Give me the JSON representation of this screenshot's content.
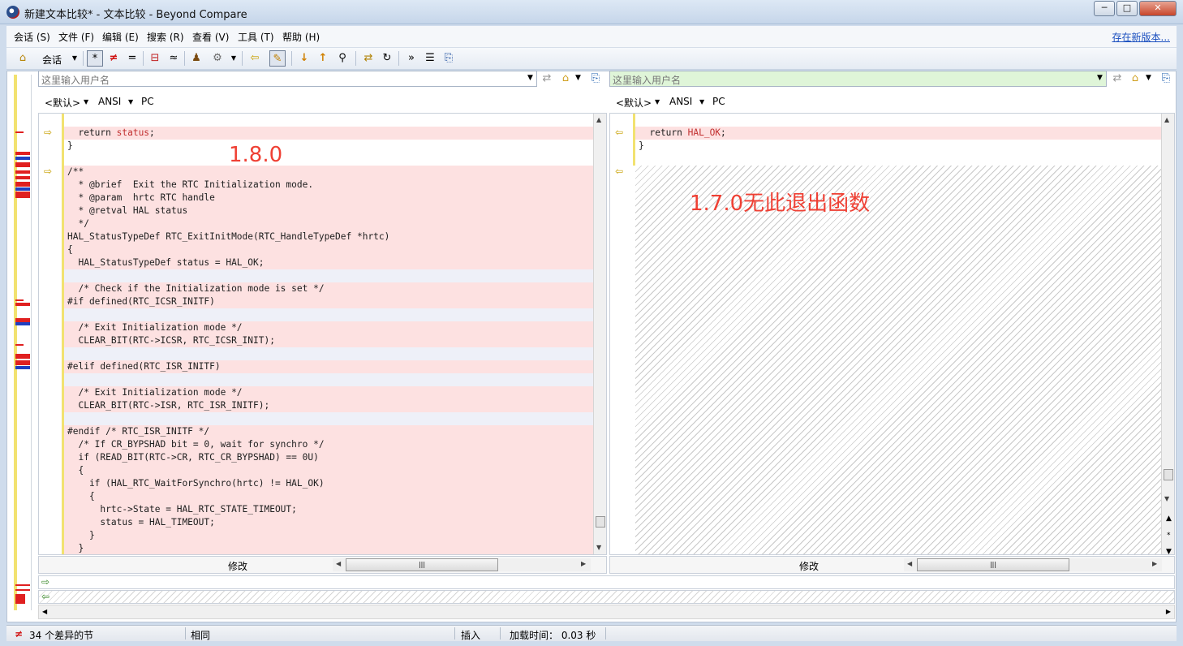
{
  "window": {
    "title": "新建文本比较* - 文本比较 - Beyond Compare",
    "minimize_glyph": "─",
    "maximize_glyph": "□",
    "close_glyph": "✕"
  },
  "menu": {
    "items": [
      "会话 (S)",
      "文件 (F)",
      "编辑 (E)",
      "搜索 (R)",
      "查看 (V)",
      "工具 (T)",
      "帮助 (H)"
    ],
    "new_version": "存在新版本..."
  },
  "toolbar": {
    "home_glyph": "⌂",
    "session_label": "会话",
    "all_glyph": "*",
    "diffs_glyph": "≠",
    "same_glyph": "=",
    "context_glyph": "⊟",
    "minor_glyph": "≈",
    "rules_glyph": "♟",
    "format_glyph": "⚙",
    "copy_left_glyph": "⇦",
    "edit_glyph": "✎",
    "next_diff_glyph": "↓",
    "prev_diff_glyph": "↑",
    "find_glyph": "⚲",
    "swap_glyph": "⇄",
    "reload_glyph": "↻",
    "expand_glyph": "»",
    "details_glyph": "☰",
    "export_glyph": "⎘"
  },
  "left_file": {
    "placeholder": "这里输入用户名",
    "format": "<默认>",
    "encoding": "ANSI",
    "line_ending": "PC",
    "status": "修改",
    "lines": [
      {
        "text": "",
        "kind": "plain"
      },
      {
        "text": "  return status;",
        "kind": "diff",
        "highlight": "status"
      },
      {
        "text": "}",
        "kind": "plain"
      },
      {
        "text": "",
        "kind": "plain"
      },
      {
        "text": "/**",
        "kind": "diff"
      },
      {
        "text": "  * @brief  Exit the RTC Initialization mode.",
        "kind": "diff"
      },
      {
        "text": "  * @param  hrtc RTC handle",
        "kind": "diff"
      },
      {
        "text": "  * @retval HAL status",
        "kind": "diff"
      },
      {
        "text": "  */",
        "kind": "diff"
      },
      {
        "text": "HAL_StatusTypeDef RTC_ExitInitMode(RTC_HandleTypeDef *hrtc)",
        "kind": "diff"
      },
      {
        "text": "{",
        "kind": "diff"
      },
      {
        "text": "  HAL_StatusTypeDef status = HAL_OK;",
        "kind": "diff"
      },
      {
        "text": "",
        "kind": "gap"
      },
      {
        "text": "  /* Check if the Initialization mode is set */",
        "kind": "diff"
      },
      {
        "text": "#if defined(RTC_ICSR_INITF)",
        "kind": "diff"
      },
      {
        "text": "",
        "kind": "gap"
      },
      {
        "text": "  /* Exit Initialization mode */",
        "kind": "diff"
      },
      {
        "text": "  CLEAR_BIT(RTC->ICSR, RTC_ICSR_INIT);",
        "kind": "diff"
      },
      {
        "text": "",
        "kind": "gap"
      },
      {
        "text": "#elif defined(RTC_ISR_INITF)",
        "kind": "diff"
      },
      {
        "text": "",
        "kind": "gap"
      },
      {
        "text": "  /* Exit Initialization mode */",
        "kind": "diff"
      },
      {
        "text": "  CLEAR_BIT(RTC->ISR, RTC_ISR_INITF);",
        "kind": "diff"
      },
      {
        "text": "",
        "kind": "gap"
      },
      {
        "text": "#endif /* RTC_ISR_INITF */",
        "kind": "diff"
      },
      {
        "text": "  /* If CR_BYPSHAD bit = 0, wait for synchro */",
        "kind": "diff"
      },
      {
        "text": "  if (READ_BIT(RTC->CR, RTC_CR_BYPSHAD) == 0U)",
        "kind": "diff"
      },
      {
        "text": "  {",
        "kind": "diff"
      },
      {
        "text": "    if (HAL_RTC_WaitForSynchro(hrtc) != HAL_OK)",
        "kind": "diff"
      },
      {
        "text": "    {",
        "kind": "diff"
      },
      {
        "text": "      hrtc->State = HAL_RTC_STATE_TIMEOUT;",
        "kind": "diff"
      },
      {
        "text": "      status = HAL_TIMEOUT;",
        "kind": "diff"
      },
      {
        "text": "    }",
        "kind": "diff"
      },
      {
        "text": "  }",
        "kind": "diff"
      }
    ]
  },
  "right_file": {
    "placeholder": "这里输入用户名",
    "format": "<默认>",
    "encoding": "ANSI",
    "line_ending": "PC",
    "status": "修改",
    "lines": [
      {
        "text": "",
        "kind": "plain"
      },
      {
        "text": "  return HAL_OK;",
        "kind": "diff",
        "highlight": "HAL_OK"
      },
      {
        "text": "}",
        "kind": "plain"
      },
      {
        "text": "",
        "kind": "plain"
      }
    ]
  },
  "annotations": {
    "left": "1.8.0",
    "right": "1.7.0无此退出函数"
  },
  "scroll_glyphs": {
    "up": "▲",
    "down": "▼",
    "left": "◀",
    "right": "▶",
    "grip": "|||",
    "dd": "▼",
    "merge_right": "⇨",
    "merge_left": "⇦",
    "gutter_right": "⇨",
    "gutter_left": "⇦"
  },
  "statusbar": {
    "diff_icon": "≠",
    "diff_count": "34 个差异的节",
    "same": "相同",
    "mode": "插入",
    "load_time": "加载时间： 0.03 秒"
  },
  "colors": {
    "diff_bg": "#fde1e1",
    "diff_text": "#c23030",
    "annotation": "#ef4034",
    "right_path_bg": "#dff5d8",
    "thumbnail_rail": "#f2e270"
  }
}
